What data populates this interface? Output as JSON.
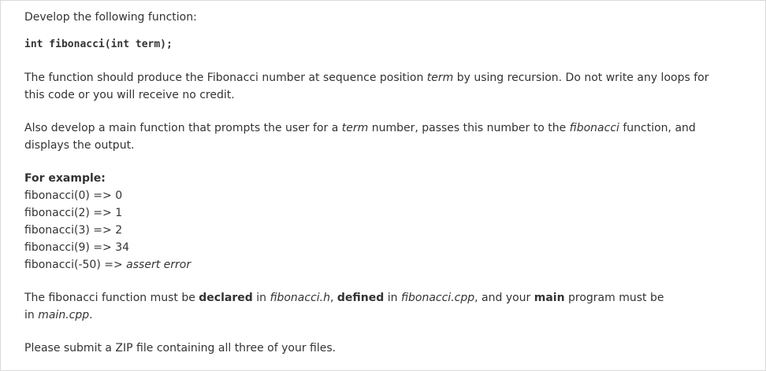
{
  "intro": "Develop the following function:",
  "signature": "int fibonacci(int term);",
  "para1": {
    "line1_a": "The function should produce the Fibonacci number at sequence position ",
    "line1_term": "term",
    "line1_b": " by using recursion. Do not write any loops for",
    "line2": "this code or you will receive no credit."
  },
  "para2": {
    "line1_a": "Also develop a main function that prompts the user for a ",
    "line1_term": "term",
    "line1_b": " number, passes this number to the ",
    "line1_func": "fibonacci",
    "line1_c": " function, and",
    "line2": "displays the output."
  },
  "example": {
    "heading": "For example:",
    "items": [
      {
        "call": "fibonacci(0) => 0",
        "tail": ""
      },
      {
        "call": "fibonacci(2) => 1",
        "tail": ""
      },
      {
        "call": "fibonacci(3) => 2",
        "tail": ""
      },
      {
        "call": "fibonacci(9) => 34",
        "tail": ""
      },
      {
        "call": "fibonacci(-50) => ",
        "tail": "assert error"
      }
    ]
  },
  "para3": {
    "a": "The fibonacci function must be ",
    "declared": "declared",
    "b": " in ",
    "file_h": "fibonacci.h",
    "c": ", ",
    "defined": "defined",
    "d": " in ",
    "file_cpp": "fibonacci.cpp",
    "e": ", and your ",
    "main": "main",
    "f": " program must be",
    "line2_a": "in ",
    "file_main": "main.cpp",
    "line2_b": "."
  },
  "submit": "Please submit a ZIP file containing all three of your files."
}
